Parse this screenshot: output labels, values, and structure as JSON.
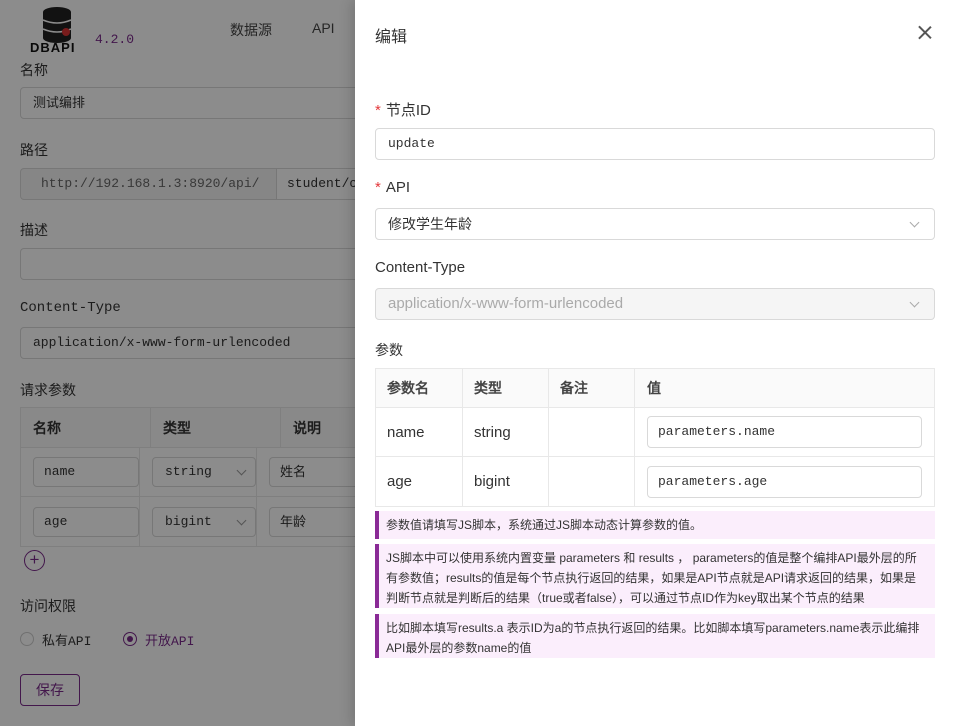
{
  "app": {
    "logo_text": "DBAPI",
    "version": "4.2.0"
  },
  "nav": [
    "数据源",
    "API"
  ],
  "form": {
    "name_label": "名称",
    "name_value": "测试编排",
    "path_label": "路径",
    "path_prefix": "http://192.168.1.3:8920/api/",
    "path_suffix": "student/c",
    "desc_label": "描述",
    "desc_value": "",
    "content_type_label": "Content-Type",
    "content_type_value": "application/x-www-form-urlencoded",
    "params_label": "请求参数",
    "params_headers": [
      "名称",
      "类型",
      "说明"
    ],
    "params_rows": [
      {
        "name": "name",
        "type": "string",
        "desc": "姓名"
      },
      {
        "name": "age",
        "type": "bigint",
        "desc": "年龄"
      }
    ],
    "access_label": "访问权限",
    "private_label": "私有API",
    "public_label": "开放API",
    "save_label": "保存"
  },
  "drawer": {
    "title": "编辑",
    "node_id_label": "节点ID",
    "node_id_value": "update",
    "api_label": "API",
    "api_value": "修改学生年龄",
    "content_type_label": "Content-Type",
    "content_type_value": "application/x-www-form-urlencoded",
    "params_label": "参数",
    "table_headers": [
      "参数名",
      "类型",
      "备注",
      "值"
    ],
    "table_rows": [
      {
        "name": "name",
        "type": "string",
        "note": "",
        "value": "parameters.name"
      },
      {
        "name": "age",
        "type": "bigint",
        "note": "",
        "value": "parameters.age"
      }
    ],
    "notes": [
      "参数值请填写JS脚本，系统通过JS脚本动态计算参数的值。",
      "JS脚本中可以使用系统内置变量 parameters 和 results ， parameters的值是整个编排API最外层的所有参数值；results的值是每个节点执行返回的结果，如果是API节点就是API请求返回的结果，如果是判断节点就是判断后的结果（true或者false），可以通过节点ID作为key取出某个节点的结果",
      "比如脚本填写results.a 表示ID为a的节点执行返回的结果。比如脚本填写parameters.name表示此编排API最外层的参数name的值"
    ]
  },
  "colors": {
    "accent": "#7a2a8a",
    "note_bg": "#fbeefc",
    "required": "#e4393c"
  }
}
